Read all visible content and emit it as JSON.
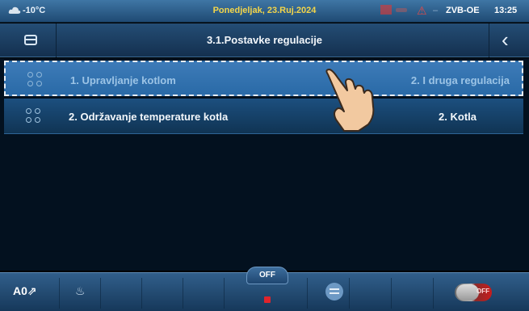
{
  "status_bar": {
    "weather_icon": "cloud-icon",
    "outside_temp": "-10°C",
    "date": "Ponedjeljak, 23.Ruj.2024",
    "warning_icon": "alarm-icon",
    "separator": "–",
    "device": "ZVB-OE",
    "time": "13:25"
  },
  "header": {
    "menu_icon": "folder-icon",
    "title": "3.1.Postavke regulacije",
    "back_icon": "chevron-left-icon",
    "back_glyph": "‹"
  },
  "list": [
    {
      "label": "1. Upravljanje kotlom",
      "value": "2. I druga regulacija",
      "selected": true
    },
    {
      "label": "2. Održavanje temperature kotla",
      "value": "2. Kotla",
      "selected": false
    }
  ],
  "bottom_bar": {
    "mode_glyph": "A0⇗",
    "flame_glyph": "♨",
    "off_label": "OFF",
    "toggle_label": "OFF",
    "accent_red": "#e0242c"
  }
}
